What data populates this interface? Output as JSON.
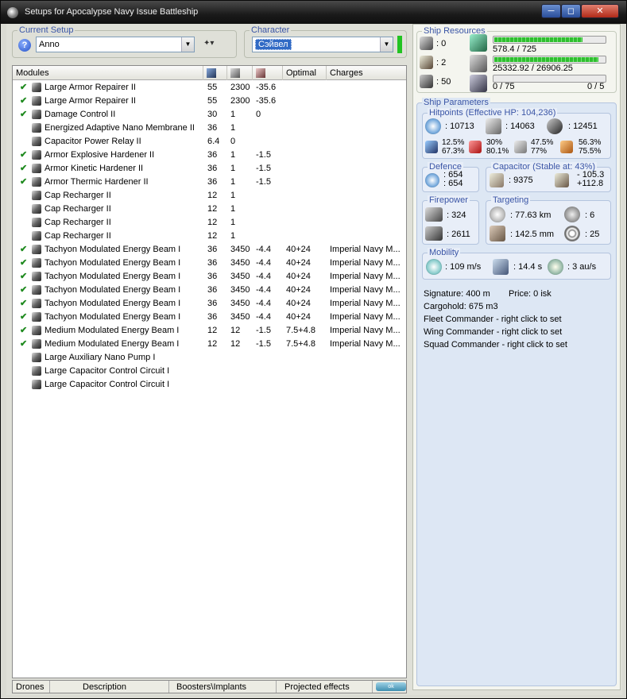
{
  "window": {
    "title": "Setups for Apocalypse Navy Issue Battleship",
    "min": "0",
    "max": "1",
    "close": "r"
  },
  "current_setup": {
    "label": "Current Setup",
    "value": "Anno"
  },
  "character": {
    "label": "Character",
    "value": "Сэйвел",
    "status_color": "#22c322"
  },
  "modules_header": {
    "name": "Modules",
    "col_optimal": "Optimal",
    "col_charges": "Charges"
  },
  "modules": [
    {
      "checked": true,
      "name": "Large Armor Repairer II",
      "cpu": "55",
      "pg": "2300",
      "cap": "-35.6",
      "optimal": "",
      "charges": ""
    },
    {
      "checked": true,
      "name": "Large Armor Repairer II",
      "cpu": "55",
      "pg": "2300",
      "cap": "-35.6",
      "optimal": "",
      "charges": ""
    },
    {
      "checked": true,
      "name": "Damage Control II",
      "cpu": "30",
      "pg": "1",
      "cap": "0",
      "optimal": "",
      "charges": ""
    },
    {
      "checked": false,
      "name": "Energized Adaptive Nano Membrane II",
      "cpu": "36",
      "pg": "1",
      "cap": "",
      "optimal": "",
      "charges": ""
    },
    {
      "checked": false,
      "name": "Capacitor Power Relay II",
      "cpu": "6.4",
      "pg": "0",
      "cap": "",
      "optimal": "",
      "charges": ""
    },
    {
      "checked": true,
      "name": "Armor Explosive Hardener II",
      "cpu": "36",
      "pg": "1",
      "cap": "-1.5",
      "optimal": "",
      "charges": ""
    },
    {
      "checked": true,
      "name": "Armor Kinetic Hardener II",
      "cpu": "36",
      "pg": "1",
      "cap": "-1.5",
      "optimal": "",
      "charges": ""
    },
    {
      "checked": true,
      "name": "Armor Thermic Hardener II",
      "cpu": "36",
      "pg": "1",
      "cap": "-1.5",
      "optimal": "",
      "charges": ""
    },
    {
      "checked": false,
      "name": "Cap Recharger II",
      "cpu": "12",
      "pg": "1",
      "cap": "",
      "optimal": "",
      "charges": ""
    },
    {
      "checked": false,
      "name": "Cap Recharger II",
      "cpu": "12",
      "pg": "1",
      "cap": "",
      "optimal": "",
      "charges": ""
    },
    {
      "checked": false,
      "name": "Cap Recharger II",
      "cpu": "12",
      "pg": "1",
      "cap": "",
      "optimal": "",
      "charges": ""
    },
    {
      "checked": false,
      "name": "Cap Recharger II",
      "cpu": "12",
      "pg": "1",
      "cap": "",
      "optimal": "",
      "charges": ""
    },
    {
      "checked": true,
      "name": "Tachyon Modulated Energy Beam I",
      "cpu": "36",
      "pg": "3450",
      "cap": "-4.4",
      "optimal": "40+24",
      "charges": "Imperial Navy M..."
    },
    {
      "checked": true,
      "name": "Tachyon Modulated Energy Beam I",
      "cpu": "36",
      "pg": "3450",
      "cap": "-4.4",
      "optimal": "40+24",
      "charges": "Imperial Navy M..."
    },
    {
      "checked": true,
      "name": "Tachyon Modulated Energy Beam I",
      "cpu": "36",
      "pg": "3450",
      "cap": "-4.4",
      "optimal": "40+24",
      "charges": "Imperial Navy M..."
    },
    {
      "checked": true,
      "name": "Tachyon Modulated Energy Beam I",
      "cpu": "36",
      "pg": "3450",
      "cap": "-4.4",
      "optimal": "40+24",
      "charges": "Imperial Navy M..."
    },
    {
      "checked": true,
      "name": "Tachyon Modulated Energy Beam I",
      "cpu": "36",
      "pg": "3450",
      "cap": "-4.4",
      "optimal": "40+24",
      "charges": "Imperial Navy M..."
    },
    {
      "checked": true,
      "name": "Tachyon Modulated Energy Beam I",
      "cpu": "36",
      "pg": "3450",
      "cap": "-4.4",
      "optimal": "40+24",
      "charges": "Imperial Navy M..."
    },
    {
      "checked": true,
      "name": "Medium Modulated Energy Beam I",
      "cpu": "12",
      "pg": "12",
      "cap": "-1.5",
      "optimal": "7.5+4.8",
      "charges": "Imperial Navy M..."
    },
    {
      "checked": true,
      "name": "Medium Modulated Energy Beam I",
      "cpu": "12",
      "pg": "12",
      "cap": "-1.5",
      "optimal": "7.5+4.8",
      "charges": "Imperial Navy M..."
    },
    {
      "checked": false,
      "name": "Large Auxiliary Nano Pump I",
      "cpu": "",
      "pg": "",
      "cap": "",
      "optimal": "",
      "charges": ""
    },
    {
      "checked": false,
      "name": "Large Capacitor Control Circuit I",
      "cpu": "",
      "pg": "",
      "cap": "",
      "optimal": "",
      "charges": ""
    },
    {
      "checked": false,
      "name": "Large Capacitor Control Circuit I",
      "cpu": "",
      "pg": "",
      "cap": "",
      "optimal": "",
      "charges": ""
    }
  ],
  "tabs": {
    "drones": "Drones",
    "description": "Description",
    "boosters": "Boosters\\Implants",
    "projected": "Projected effects",
    "badge": "ok"
  },
  "resources": {
    "label": "Ship Resources",
    "hardpoints_turrets": ": 0",
    "hardpoints_launchers": ": 2",
    "drone_bay": ": 50",
    "cpu": "578.4 / 725",
    "cpu_fill": 0.8,
    "powergrid": "25332.92 / 26906.25",
    "pg_fill": 0.94,
    "calibration": "0 / 75",
    "rigs": "0 / 5",
    "cal_fill": 0.0
  },
  "parameters": {
    "label": "Ship Parameters",
    "hitpoints_label": "Hitpoints (Effective HP: 104,236)",
    "shield_hp": ": 10713",
    "armor_hp": ": 14063",
    "structure_hp": ": 12451",
    "res_em_shield": "12.5%",
    "res_em_armor": "67.3%",
    "res_th_shield": "30%",
    "res_th_armor": "80.1%",
    "res_ki_shield": "47.5%",
    "res_ki_armor": "77%",
    "res_ex_shield": "56.3%",
    "res_ex_armor": "75.5%",
    "defence_label": "Defence",
    "defence_1": ": 654",
    "defence_2": ": 654",
    "capacitor_label": "Capacitor (Stable at: 43%)",
    "cap_amount": ": 9375",
    "cap_delta_1": "- 105.3",
    "cap_delta_2": "+112.8",
    "firepower_label": "Firepower",
    "fp_volley": ": 324",
    "fp_dps": ": 2611",
    "targeting_label": "Targeting",
    "range": ": 77.63 km",
    "max_targets": ": 6",
    "scan_res": ": 142.5 mm",
    "sensor": ": 25",
    "mobility_label": "Mobility",
    "velocity": ": 109 m/s",
    "align": ": 14.4 s",
    "warp": ": 3 au/s",
    "signature": "Signature: 400 m",
    "price": "Price: 0 isk",
    "cargohold": "Cargohold: 675 m3",
    "fleet_cmd": "Fleet Commander - right click to set",
    "wing_cmd": "Wing Commander - right click to set",
    "squad_cmd": "Squad Commander - right click to set"
  }
}
